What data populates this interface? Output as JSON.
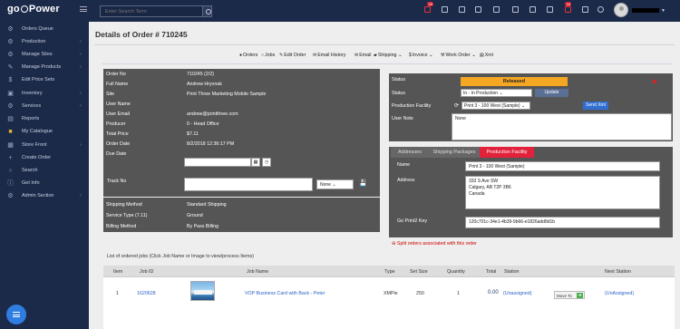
{
  "app": {
    "logo_text": "go",
    "logo_text2": "Power"
  },
  "topbar": {
    "search_placeholder": "Enter Search Term",
    "badges": [
      "29",
      "16"
    ]
  },
  "sidebar": {
    "items": [
      {
        "label": "Orders Queue",
        "icon": "gear-icon",
        "arrow": false
      },
      {
        "label": "Production",
        "icon": "cogs-icon",
        "arrow": true
      },
      {
        "label": "Manage Sites",
        "icon": "gears-icon",
        "arrow": true
      },
      {
        "label": "Manage Products",
        "icon": "wrench-icon",
        "arrow": true
      },
      {
        "label": "Edit Price Sets",
        "icon": "dollar-icon",
        "arrow": false
      },
      {
        "label": "Inventory",
        "icon": "box-icon",
        "arrow": true
      },
      {
        "label": "Services",
        "icon": "gear-icon",
        "arrow": true
      },
      {
        "label": "Reports",
        "icon": "chart-icon",
        "arrow": false
      },
      {
        "label": "My Catalogue",
        "icon": "folder-icon",
        "arrow": false
      },
      {
        "label": "Store Front",
        "icon": "cart-icon",
        "arrow": true
      },
      {
        "label": "Create Order",
        "icon": "plus-icon",
        "arrow": false
      },
      {
        "label": "Search",
        "icon": "search-icon",
        "arrow": false
      },
      {
        "label": "Get Info",
        "icon": "info-icon",
        "arrow": false
      },
      {
        "label": "Admin Section",
        "icon": "gear-icon",
        "arrow": true
      }
    ]
  },
  "page": {
    "title": "Details of Order # 710245"
  },
  "toolbar": {
    "items": [
      "Orders",
      "Jobs",
      "Edit Order",
      "Email History",
      "Email",
      "Shipping",
      "Invoice",
      "Work Order",
      "Xml"
    ]
  },
  "order": {
    "rows": [
      {
        "k": "Order No",
        "v": "710245 (2/2)"
      },
      {
        "k": "Full Name",
        "v": "Andrew Hryvnak"
      },
      {
        "k": "Site",
        "v": "Print Three Marketing Mobile Sample"
      },
      {
        "k": "User Name",
        "v": ""
      },
      {
        "k": "User Email",
        "v": "andrew@printthree.com"
      },
      {
        "k": "Producer",
        "v": "0 - Head Office"
      },
      {
        "k": "Total Price",
        "v": "$7.11"
      },
      {
        "k": "Order Date",
        "v": "8/2/2018 12:36:17 PM"
      },
      {
        "k": "Due Date",
        "v": ""
      }
    ],
    "track_label": "Track No",
    "track_select": "None",
    "lower": [
      {
        "k": "Shipping Method",
        "v": "Standard Shipping"
      },
      {
        "k": "Service Type (7.11)",
        "v": "Ground"
      },
      {
        "k": "Billing Method",
        "v": "By Pass Billing"
      }
    ]
  },
  "status_panel": {
    "status_label": "Status",
    "status_value": "Released",
    "status2_label": "Status",
    "status_select": "In - In Production",
    "update_button": "Update",
    "facility_label": "Production Facility",
    "facility_select": "Print 3 - 100 West (Sample)",
    "send_xml_button": "Send Xml",
    "note_label": "User Note",
    "note_value": "None"
  },
  "tabs": {
    "labels": [
      "Addresses",
      "Shipping Packages",
      "Production Facility"
    ],
    "name_label": "Name",
    "name_value": "Print 3 - 100 West (Sample)",
    "address_label": "Address",
    "address_lines": [
      "333 S Ave SW",
      "Calgary, AB T2P 3B6",
      "Canada"
    ],
    "key_label": "Go Print2 Key",
    "key_value": "120c701c-34e1-4b39-9b66-e1826add8d1b"
  },
  "split_text": "Split orders associated with this order",
  "jobs": {
    "list_label": "List of ordered jobs (Click Job Name or Image to view/process Items)",
    "headers": [
      "Item",
      "Job ID",
      "Job Name",
      "Type",
      "Set Size",
      "Quantity",
      "Total",
      "Station",
      "Next Station"
    ],
    "rows": [
      {
        "item": "1",
        "job_id": "1620628",
        "job_name": "VOP Business Card with Back - Peter",
        "type": "XMPie",
        "set_size": "250",
        "quantity": "1",
        "total": "0.00",
        "station": "(Unassigned)",
        "move": "Move To",
        "next_station": "(UnAssigned)"
      }
    ]
  }
}
